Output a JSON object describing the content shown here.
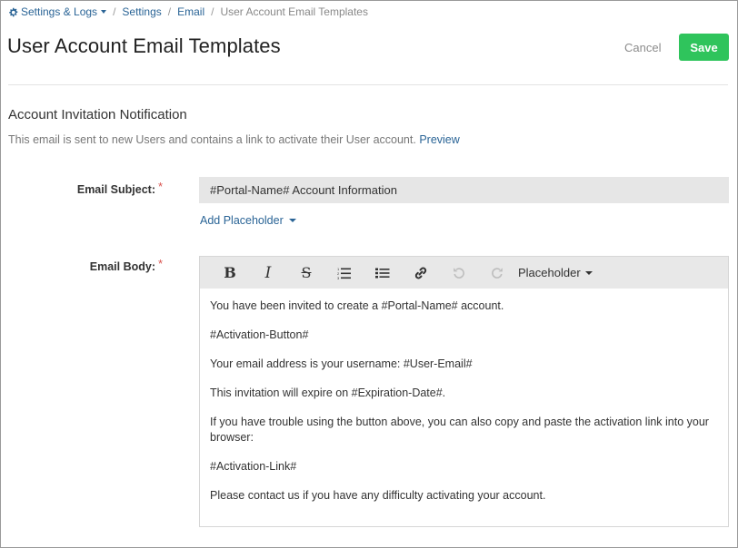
{
  "breadcrumb": {
    "root": "Settings & Logs",
    "items": [
      "Settings",
      "Email"
    ],
    "current": "User Account Email Templates"
  },
  "header": {
    "title": "User Account Email Templates",
    "cancel_label": "Cancel",
    "save_label": "Save"
  },
  "section": {
    "title": "Account Invitation Notification",
    "description": "This email is sent to new Users and contains a link to activate their User account.",
    "preview_link": "Preview"
  },
  "form": {
    "subject_label": "Email Subject:",
    "subject_value": "#Portal-Name# Account Information",
    "add_placeholder_label": "Add Placeholder",
    "body_label": "Email Body:",
    "required_mark": "*"
  },
  "editor": {
    "toolbar": {
      "bold": "B",
      "italic": "I",
      "strike": "S",
      "placeholder_label": "Placeholder"
    },
    "paragraphs": [
      "You have been invited to create a #Portal-Name# account.",
      "#Activation-Button#",
      "Your email address is your username: #User-Email#",
      "This invitation will expire on #Expiration-Date#.",
      "If you have trouble using the button above, you can also copy and paste the activation link into your browser:",
      "#Activation-Link#",
      "Please contact us if you have any difficulty activating your account."
    ]
  },
  "colors": {
    "accent_link": "#2a6496",
    "save_button": "#2fc45c",
    "required": "#d9534f"
  },
  "icons": [
    "gear-icon",
    "ordered-list-icon",
    "unordered-list-icon",
    "link-icon",
    "undo-icon",
    "redo-icon"
  ]
}
